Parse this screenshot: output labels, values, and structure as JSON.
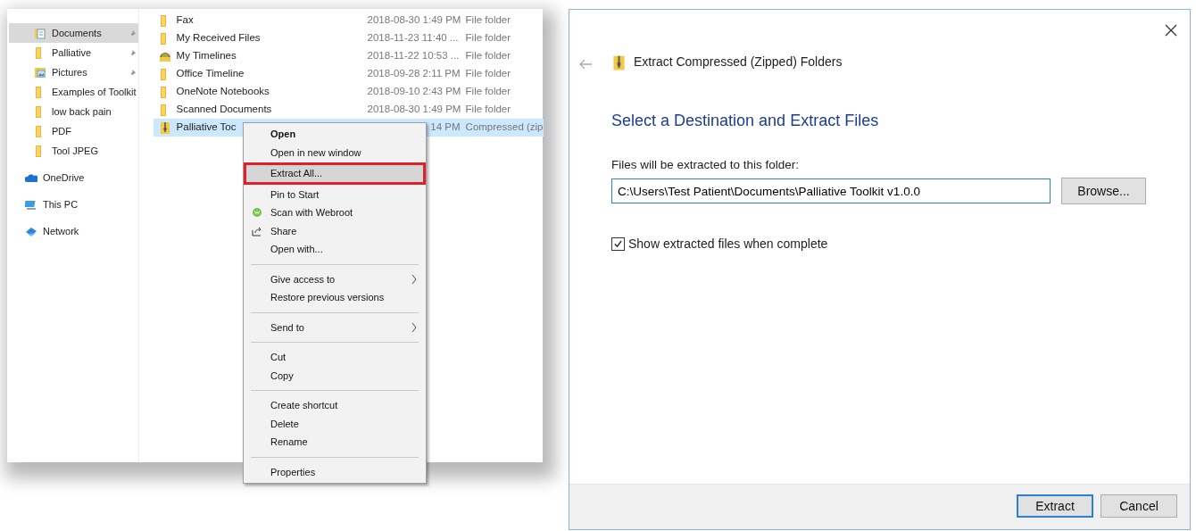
{
  "explorer": {
    "nav_items": [
      {
        "label": "Documents",
        "kind": "documents",
        "pinned": true,
        "selected": true
      },
      {
        "label": "Palliative",
        "kind": "folder",
        "pinned": true,
        "selected": false
      },
      {
        "label": "Pictures",
        "kind": "pictures",
        "pinned": true,
        "selected": false
      },
      {
        "label": "Examples of Toolkit",
        "kind": "folder",
        "pinned": false,
        "selected": false
      },
      {
        "label": "low back pain",
        "kind": "folder",
        "pinned": false,
        "selected": false
      },
      {
        "label": "PDF",
        "kind": "folder",
        "pinned": false,
        "selected": false
      },
      {
        "label": "Tool JPEG",
        "kind": "folder",
        "pinned": false,
        "selected": false
      },
      {
        "label": "OneDrive",
        "kind": "cloud",
        "pinned": false,
        "selected": false
      },
      {
        "label": "This PC",
        "kind": "pc",
        "pinned": false,
        "selected": false
      },
      {
        "label": "Network",
        "kind": "network",
        "pinned": false,
        "selected": false
      }
    ],
    "files": [
      {
        "name": "Fax",
        "date": "2018-08-30 1:49 PM",
        "type": "File folder",
        "kind": "folder",
        "selected": false
      },
      {
        "name": "My Received Files",
        "date": "2018-11-23 11:40 ...",
        "type": "File folder",
        "kind": "folder",
        "selected": false
      },
      {
        "name": "My Timelines",
        "date": "2018-11-22 10:53 ...",
        "type": "File folder",
        "kind": "timeline",
        "selected": false
      },
      {
        "name": "Office Timeline",
        "date": "2018-09-28 2:11 PM",
        "type": "File folder",
        "kind": "folder",
        "selected": false
      },
      {
        "name": "OneNote Notebooks",
        "date": "2018-09-10 2:43 PM",
        "type": "File folder",
        "kind": "folder",
        "selected": false
      },
      {
        "name": "Scanned Documents",
        "date": "2018-08-30 1:49 PM",
        "type": "File folder",
        "kind": "folder",
        "selected": false
      },
      {
        "name": "Palliative Toc",
        "date": "14 PM",
        "type": "Compressed (zip",
        "kind": "zip",
        "selected": true
      }
    ]
  },
  "context_menu": {
    "groups": [
      [
        {
          "label": "Open",
          "bold": true,
          "highlighted": false,
          "submenu": false
        },
        {
          "label": "Open in new window",
          "bold": false,
          "highlighted": false,
          "submenu": false
        },
        {
          "label": "Extract All...",
          "bold": false,
          "highlighted": true,
          "submenu": false
        },
        {
          "label": "Pin to Start",
          "bold": false,
          "highlighted": false,
          "submenu": false
        },
        {
          "label": "Scan with Webroot",
          "bold": false,
          "highlighted": false,
          "submenu": false,
          "kind": "webroot"
        },
        {
          "label": "Share",
          "bold": false,
          "highlighted": false,
          "submenu": false,
          "kind": "share"
        },
        {
          "label": "Open with...",
          "bold": false,
          "highlighted": false,
          "submenu": false
        }
      ],
      [
        {
          "label": "Give access to",
          "bold": false,
          "highlighted": false,
          "submenu": true
        },
        {
          "label": "Restore previous versions",
          "bold": false,
          "highlighted": false,
          "submenu": false
        }
      ],
      [
        {
          "label": "Send to",
          "bold": false,
          "highlighted": false,
          "submenu": true
        }
      ],
      [
        {
          "label": "Cut",
          "bold": false,
          "highlighted": false,
          "submenu": false
        },
        {
          "label": "Copy",
          "bold": false,
          "highlighted": false,
          "submenu": false
        }
      ],
      [
        {
          "label": "Create shortcut",
          "bold": false,
          "highlighted": false,
          "submenu": false
        },
        {
          "label": "Delete",
          "bold": false,
          "highlighted": false,
          "submenu": false
        },
        {
          "label": "Rename",
          "bold": false,
          "highlighted": false,
          "submenu": false
        }
      ],
      [
        {
          "label": "Properties",
          "bold": false,
          "highlighted": false,
          "submenu": false
        }
      ]
    ]
  },
  "dialog": {
    "title": "Extract Compressed (Zipped) Folders",
    "heading": "Select a Destination and Extract Files",
    "field_label": "Files will be extracted to this folder:",
    "path": "C:\\Users\\Test Patient\\Documents\\Palliative Toolkit v1.0.0",
    "browse_button": "Browse...",
    "checkbox": {
      "label": "Show extracted files when complete",
      "checked": true
    },
    "buttons": [
      {
        "label": "Extract",
        "default": true
      },
      {
        "label": "Cancel",
        "default": false
      }
    ]
  }
}
